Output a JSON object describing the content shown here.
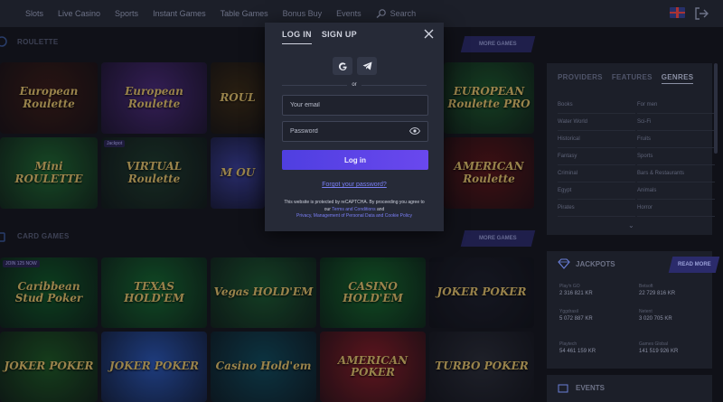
{
  "nav": {
    "items": [
      "Slots",
      "Live Casino",
      "Sports",
      "Instant Games",
      "Table Games",
      "Bonus Buy",
      "Events"
    ],
    "search_label": "Search"
  },
  "roulette": {
    "title": "ROULETTE",
    "more_label": "MORE GAMES",
    "tiles": [
      {
        "name": "European Roulette",
        "label": "European Roulette",
        "bg": "#3a1b14"
      },
      {
        "name": "European Roulette 2",
        "label": "European Roulette",
        "bg": "#4b2a7a"
      },
      {
        "name": "Roulette 3",
        "label": "ROUL",
        "bg": "#3a2a12"
      },
      {
        "name": "European Roulette Pro",
        "label": "EUROPEAN Roulette PRO",
        "bg": "#1b5a2a"
      },
      {
        "name": "Mini Roulette",
        "label": "Mini ROULETTE",
        "bg": "#1f6a2f"
      },
      {
        "name": "Virtual Roulette",
        "label": "VIRTUAL Roulette",
        "bg": "#1d3b2a",
        "badge": "Jackpot"
      },
      {
        "name": "Roulette 7",
        "label": "M   OU",
        "bg": "#3a3f9a"
      },
      {
        "name": "American Roulette",
        "label": "AMERICAN Roulette",
        "bg": "#5a1414"
      }
    ]
  },
  "card_games": {
    "title": "CARD GAMES",
    "more_label": "MORE GAMES",
    "tiles": [
      {
        "name": "Caribbean Stud Poker",
        "label": "Caribbean Stud Poker",
        "bg": "#0f5a26",
        "badge": "JOIN 125 NOW"
      },
      {
        "name": "Texas Hold'em",
        "label": "TEXAS HOLD'EM",
        "bg": "#146a2e"
      },
      {
        "name": "Vegas Hold'em",
        "label": "Vegas HOLD'EM",
        "bg": "#1a5a2e"
      },
      {
        "name": "Casino Hold'em",
        "label": "CASINO HOLD'EM",
        "bg": "#136b2a"
      },
      {
        "name": "Joker Poker",
        "label": "JOKER POKER",
        "bg": "#1c1f29"
      },
      {
        "name": "Joker Poker 2",
        "label": "JOKER POKER",
        "bg": "#1d5a22"
      },
      {
        "name": "Joker Poker 3",
        "label": "JOKER POKER",
        "bg": "#2a58b8"
      },
      {
        "name": "Casino Hold'em 2",
        "label": "Casino Hold'em",
        "bg": "#0f4a5a"
      },
      {
        "name": "American Poker",
        "label": "AMERICAN POKER",
        "bg": "#8a1d25"
      },
      {
        "name": "Turbo Poker",
        "label": "TURBO POKER",
        "bg": "#2a2d36"
      }
    ]
  },
  "filters": {
    "tabs": [
      "PROVIDERS",
      "FEATURES",
      "GENRES"
    ],
    "genres_left": [
      "Books",
      "Water World",
      "Historical",
      "Fantasy",
      "Criminal",
      "Egypt",
      "Pirates"
    ],
    "genres_right": [
      "For men",
      "Sci-Fi",
      "Fruits",
      "Sports",
      "Bars & Restaurants",
      "Animals",
      "Horror"
    ]
  },
  "jackpots": {
    "title": "JACKPOTS",
    "read_more": "READ MORE",
    "items": [
      {
        "provider": "Play'n GO",
        "value": "2 316 821 KR"
      },
      {
        "provider": "Betsoft",
        "value": "22 729 816 KR"
      },
      {
        "provider": "Yggdrasil",
        "value": "5 072 887 KR"
      },
      {
        "provider": "Netent",
        "value": "3 020 705 KR"
      },
      {
        "provider": "Playtech",
        "value": "54 461 159 KR"
      },
      {
        "provider": "Games Global",
        "value": "141 519 926 KR"
      }
    ]
  },
  "events": {
    "title": "EVENTS"
  },
  "modal": {
    "tab_login": "LOG IN",
    "tab_signup": "SIGN UP",
    "or": "or",
    "email_placeholder": "Your email",
    "password_placeholder": "Password",
    "login_button": "Log in",
    "forgot": "Forgot your password?",
    "legal_1": "This website is protected by reCAPTCHA. By proceeding you agree to our ",
    "legal_terms": "Terms and Conditions",
    "legal_and": " and",
    "legal_privacy": "Privacy, Management of Personal Data and Cookie Policy"
  },
  "colors": {
    "accent": "#5a44e8",
    "link": "#7a7ff6",
    "background": "#14161d",
    "panel": "#1c1f29",
    "modal": "#262a37"
  }
}
